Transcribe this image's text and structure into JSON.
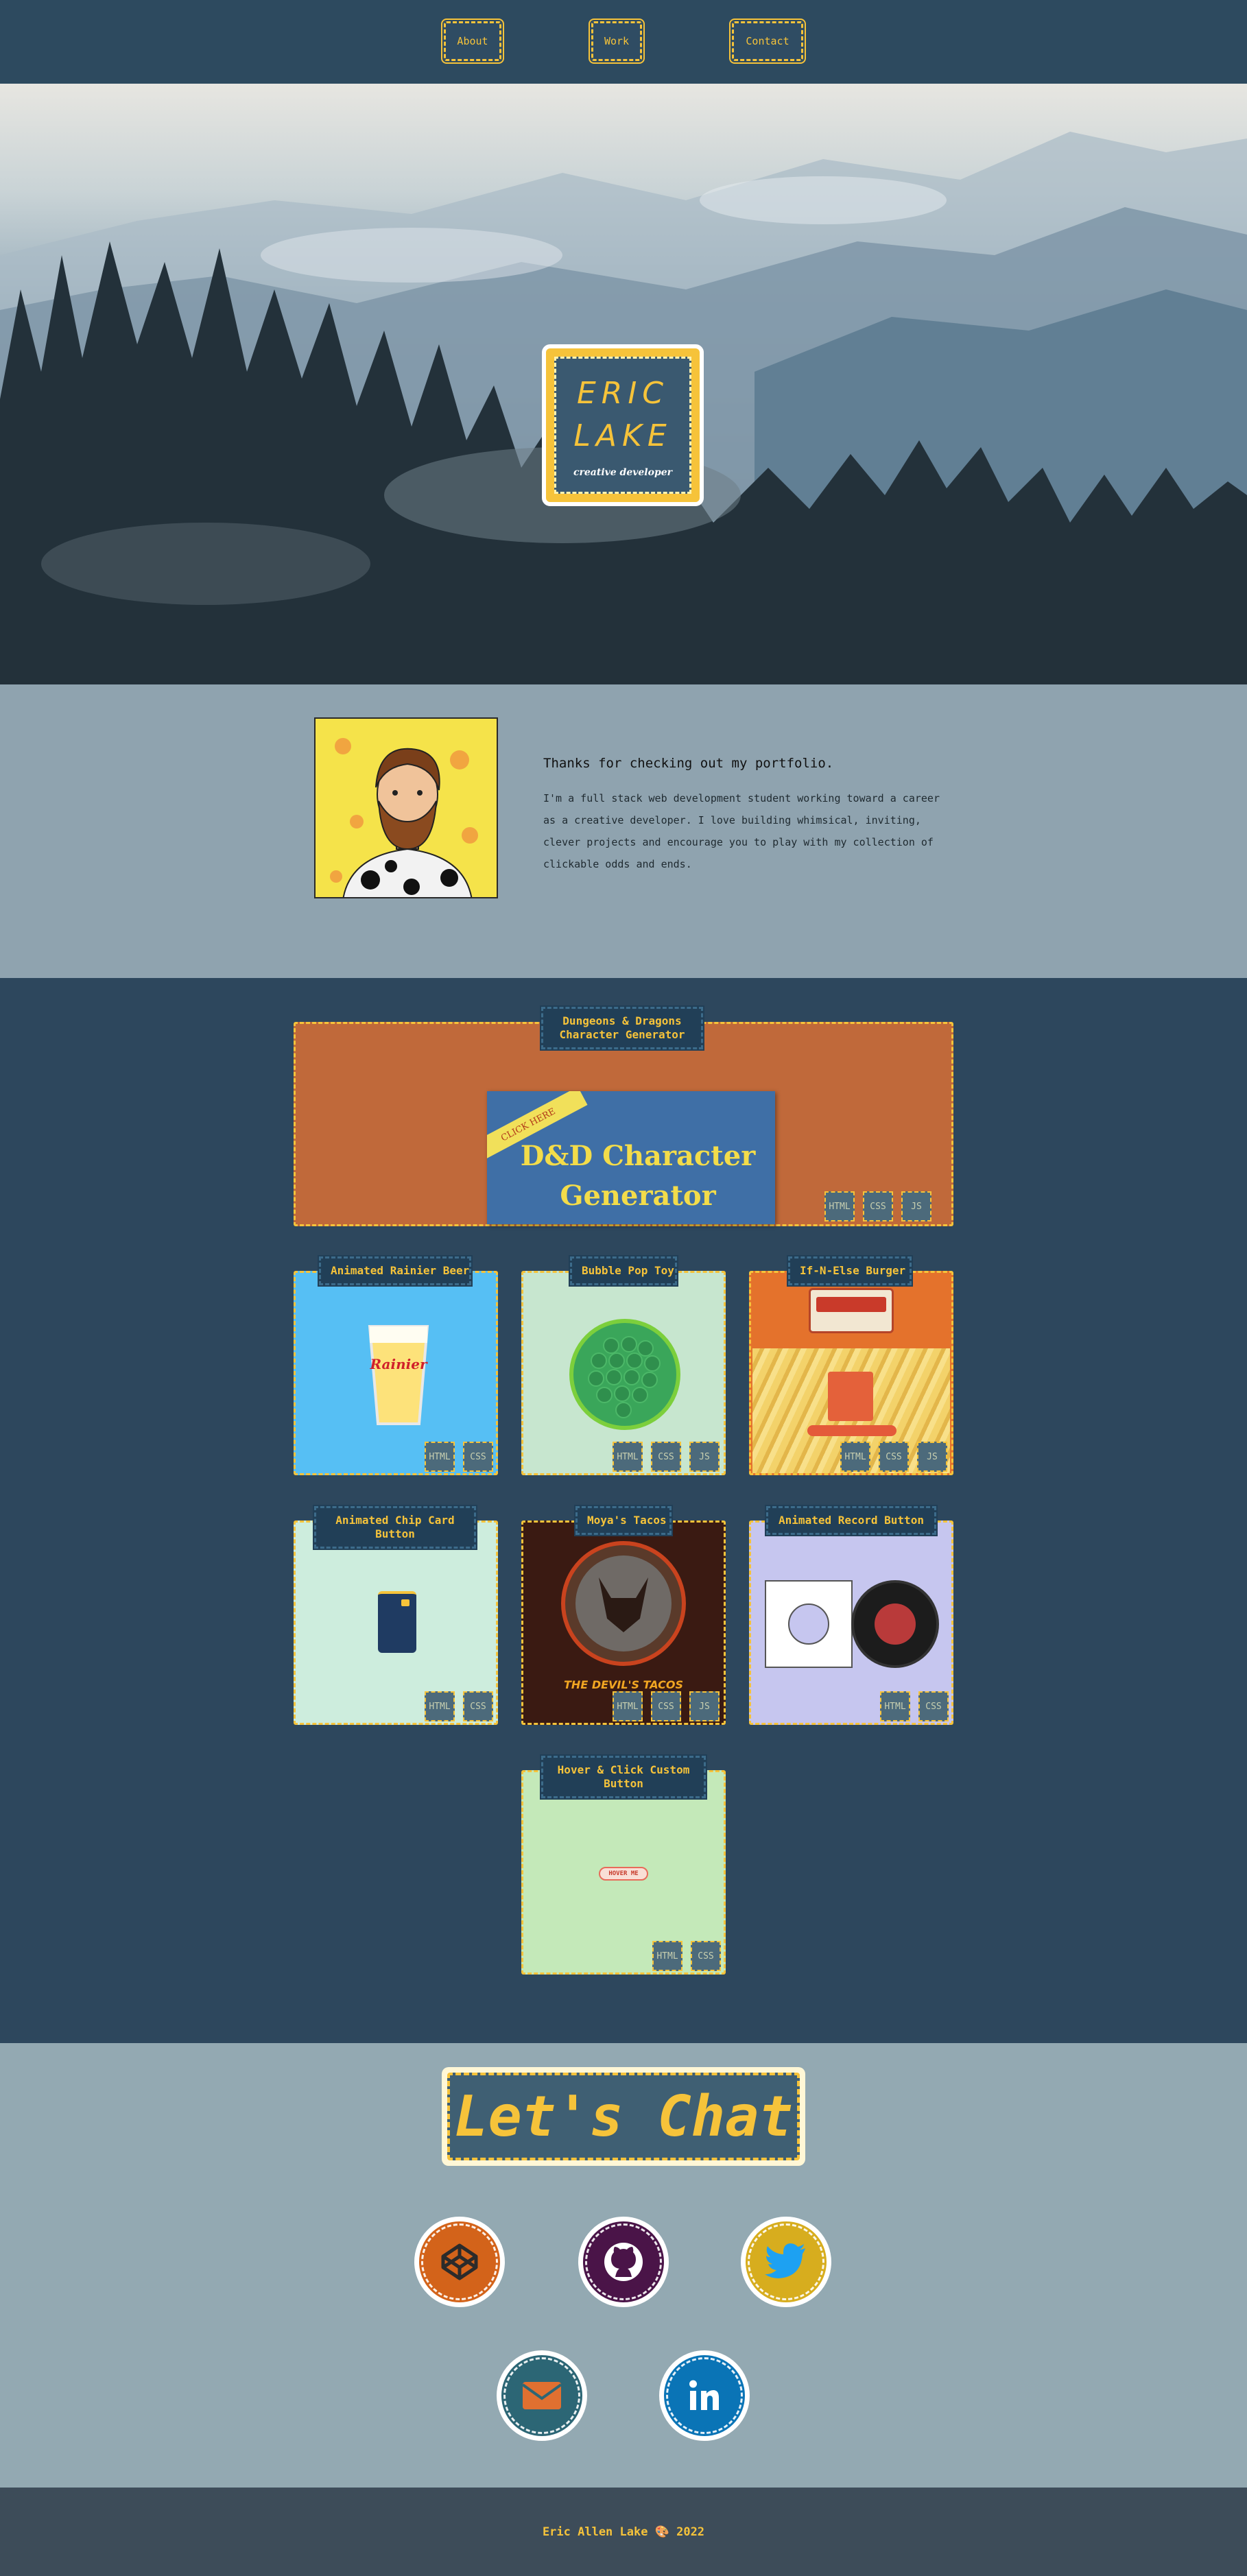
{
  "nav": {
    "items": [
      "About",
      "Work",
      "Contact"
    ]
  },
  "hero": {
    "name_line1": "ERIC",
    "name_line2": "LAKE",
    "tagline": "creative developer"
  },
  "about": {
    "title": "Thanks for checking out my portfolio.",
    "body": "I'm a full stack web development student working toward a career as a creative developer. I love building whimsical, inviting, clever projects and encourage you to play with my collection of clickable odds and ends."
  },
  "projects": [
    {
      "label": "Dungeons & Dragons\nCharacter Generator",
      "preview_text": "D&D Character Generator",
      "ribbon": "CLICK HERE",
      "tags": [
        "HTML",
        "CSS",
        "JS"
      ]
    },
    {
      "label": "Animated Rainier Beer",
      "preview_text": "Rainier",
      "tags": [
        "HTML",
        "CSS"
      ]
    },
    {
      "label": "Bubble Pop Toy",
      "tags": [
        "HTML",
        "CSS",
        "JS"
      ]
    },
    {
      "label": "If-N-Else Burger",
      "tags": [
        "HTML",
        "CSS",
        "JS"
      ]
    },
    {
      "label": "Animated Chip Card\nButton",
      "tags": [
        "HTML",
        "CSS"
      ]
    },
    {
      "label": "Moya's Tacos",
      "preview_text": "THE DEVIL'S TACOS",
      "tags": [
        "HTML",
        "CSS",
        "JS"
      ]
    },
    {
      "label": "Animated Record Button",
      "tags": [
        "HTML",
        "CSS"
      ]
    },
    {
      "label": "Hover & Click Custom\nButton",
      "preview_text": "HOVER ME",
      "tags": [
        "HTML",
        "CSS"
      ]
    }
  ],
  "chat": {
    "heading": "Let's Chat"
  },
  "social": [
    {
      "name": "codepen-icon",
      "color": "#d3631a"
    },
    {
      "name": "github-icon",
      "color": "#4a1448"
    },
    {
      "name": "twitter-icon",
      "color": "#d7ad1e"
    },
    {
      "name": "email-icon",
      "color": "#2c6675"
    },
    {
      "name": "linkedin-icon",
      "color": "#0a74b6"
    }
  ],
  "footer": {
    "text": "Eric Allen Lake 🎨 2022"
  },
  "colors": {
    "accent": "#f6c33a",
    "navy": "#2d475d",
    "slate": "#8fa3af"
  }
}
